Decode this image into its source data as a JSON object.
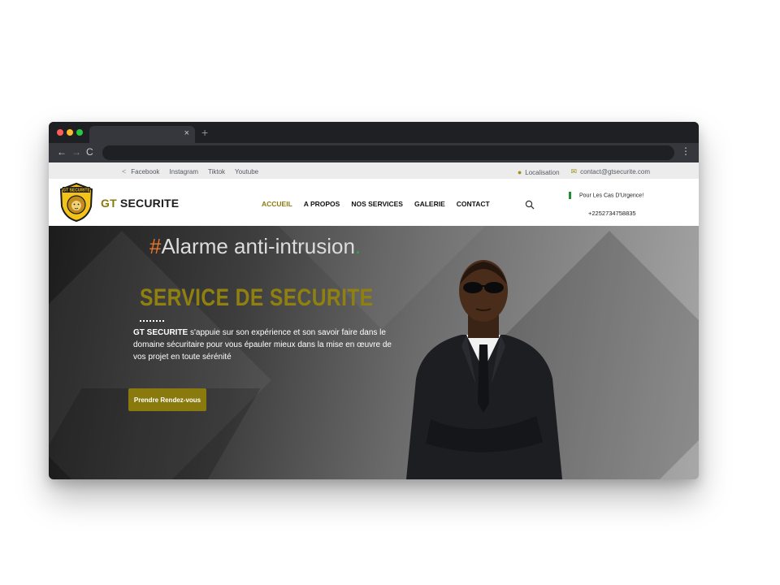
{
  "browser": {
    "tab_close": "×",
    "new_tab": "+",
    "back": "←",
    "forward": "→",
    "reload": "C",
    "menu": "⋮"
  },
  "topbar": {
    "social": [
      "Facebook",
      "Instagram",
      "Tiktok",
      "Youtube"
    ],
    "location": "Localisation",
    "email": "contact@gtsecurite.com"
  },
  "header": {
    "logo_text": "GT SECURITE",
    "brand_prefix": "GT",
    "brand_suffix": " SECURITE",
    "nav": [
      "ACCUEIL",
      "A PROPOS",
      "NOS SERVICES",
      "GALERIE",
      "CONTACT"
    ],
    "urgency_label": "Pour Les Cas D'Urgence!",
    "phone": "+2252734758835"
  },
  "hero": {
    "hash": "#",
    "tagline": "Alarme anti-intrusion",
    "tagline_dot": ".",
    "title": "SERVICE DE SECURITE",
    "desc_bold": "GT SECURITE",
    "desc_rest": " s'appuie sur son expérience et son savoir faire dans le domaine sécuritaire pour vous épauler mieux dans la mise en œuvre de vos projet en toute sérénité",
    "cta": "Prendre Rendez-vous"
  },
  "colors": {
    "accent": "#8a7a0e",
    "hash": "#e8772b",
    "dot": "#2fa84a",
    "chrome": "#25272b"
  }
}
